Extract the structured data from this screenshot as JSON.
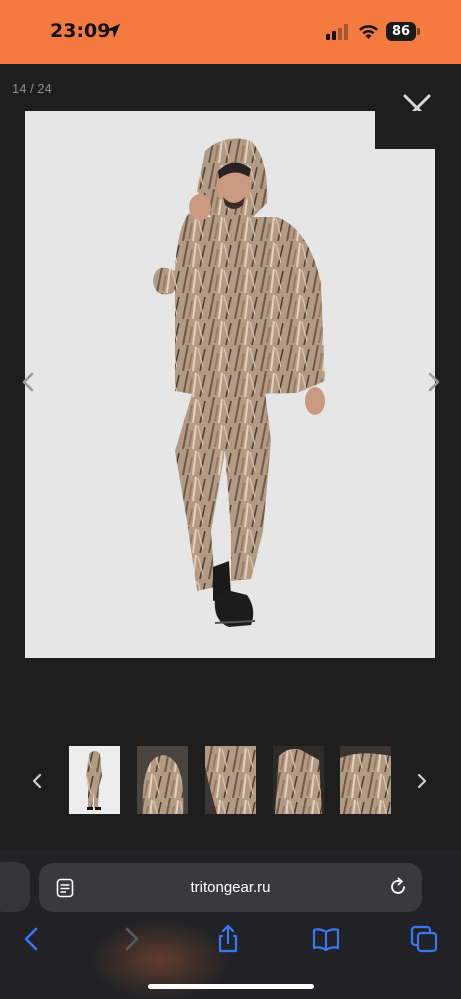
{
  "status_bar": {
    "time": "23:09",
    "battery": "86",
    "color": "#f57a3f"
  },
  "gallery": {
    "counter": "14 / 24",
    "main_image": "man-in-reed-camouflage-rain-suit",
    "thumbnails": [
      {
        "name": "full-body-suit",
        "active": true
      },
      {
        "name": "hood-back-detail"
      },
      {
        "name": "sleeve-detail"
      },
      {
        "name": "jacket-closeup"
      },
      {
        "name": "jacket-front"
      }
    ]
  },
  "browser": {
    "url": "tritongear.ru",
    "icons": [
      "reader-icon",
      "reload-icon",
      "back-icon",
      "forward-icon",
      "share-icon",
      "bookmarks-icon",
      "tabs-icon"
    ],
    "accent": "#3478f6"
  }
}
